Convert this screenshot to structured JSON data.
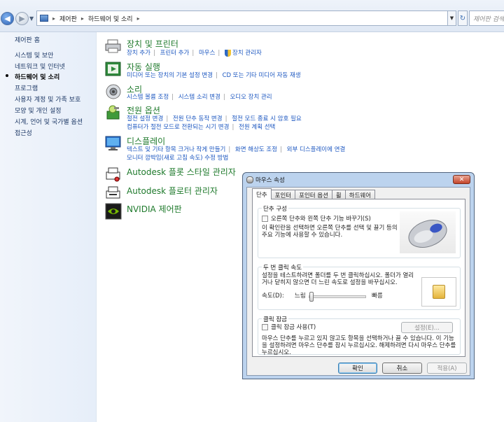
{
  "address_bar": {
    "crumbs": [
      "제어판",
      "하드웨어 및 소리"
    ],
    "search_placeholder": "제어판 검색"
  },
  "left_nav": {
    "home": "제어판 홈",
    "items": [
      "시스템 및 보안",
      "네트워크 및 인터넷",
      "하드웨어 및 소리",
      "프로그램",
      "사용자 계정 및 가족 보호",
      "모양 및 개인 설정",
      "시계, 언어 및 국가별 옵션",
      "접근성"
    ]
  },
  "categories": [
    {
      "title": "장치 및 프린터",
      "icon": "printer-icon",
      "links": [
        [
          "장치 추가",
          "프린터 추가",
          "마우스",
          "장치 관리자"
        ]
      ]
    },
    {
      "title": "자동 실행",
      "icon": "autoplay-icon",
      "links": [
        [
          "미디어 또는 장치의 기본 설정 변경",
          "CD 또는 기타 미디어 자동 재생"
        ]
      ]
    },
    {
      "title": "소리",
      "icon": "speaker-icon",
      "links": [
        [
          "시스템 볼륨 조정",
          "시스템 소리 변경",
          "오디오 장치 관리"
        ]
      ]
    },
    {
      "title": "전원 옵션",
      "icon": "power-icon",
      "links": [
        [
          "절전 설정 변경",
          "전원 단추 동작 변경",
          "절전 모드 종료 시 암호 필요"
        ],
        [
          "컴퓨터가 절전 모드로 전환되는 시기 변경",
          "전원 계획 선택"
        ]
      ]
    },
    {
      "title": "디스플레이",
      "icon": "display-icon",
      "links": [
        [
          "텍스트 및 기타 항목 크거나 작게 만들기",
          "화면 해상도 조정",
          "외부 디스플레이에 연결"
        ],
        [
          "모니터 깜박임(새로 고침 속도) 수정 방법"
        ]
      ]
    },
    {
      "title": "Autodesk 플롯 스타일 관리자",
      "icon": "autodesk-plotstyle-icon",
      "links": []
    },
    {
      "title": "Autodesk 플로터 관리자",
      "icon": "autodesk-plotter-icon",
      "links": []
    },
    {
      "title": "NVIDIA 제어판",
      "icon": "nvidia-icon",
      "links": []
    }
  ],
  "dialog": {
    "title": "마우스 속성",
    "tabs": [
      "단추",
      "포인터",
      "포인터 옵션",
      "휠",
      "하드웨어"
    ],
    "button_config": {
      "legend": "단추 구성",
      "checkbox": "오른쪽 단추와 왼쪽 단추 기능 바꾸기(S)",
      "desc": "이 확인란을 선택하면 오른쪽 단추를 선택 및 끌기 등의 주요 기능에 사용할 수 있습니다."
    },
    "double_click": {
      "legend": "두 번 클릭 속도",
      "desc": "설정을 테스트하려면 폴더를 두 번 클릭하십시오. 폴더가 열리거나 닫히지 않으면 더 느린 속도로 설정을 바꾸십시오.",
      "speed_label": "속도(D):",
      "slow": "느림",
      "fast": "빠름",
      "speed_level": 0.0
    },
    "click_lock": {
      "legend": "클릭 잠금",
      "checkbox": "클릭 잠금 사용(T)",
      "settings_button": "설정(E)...",
      "desc": "마우스 단추를 누르고 있지 않고도 항목을 선택하거나 끌 수 있습니다. 이 기능을 설정하려면 마우스 단추를 잠시 누르십시오. 해제하려면 다시 마우스 단추를 누르십시오."
    },
    "buttons": {
      "ok": "확인",
      "cancel": "취소",
      "apply": "적용(A)"
    }
  }
}
